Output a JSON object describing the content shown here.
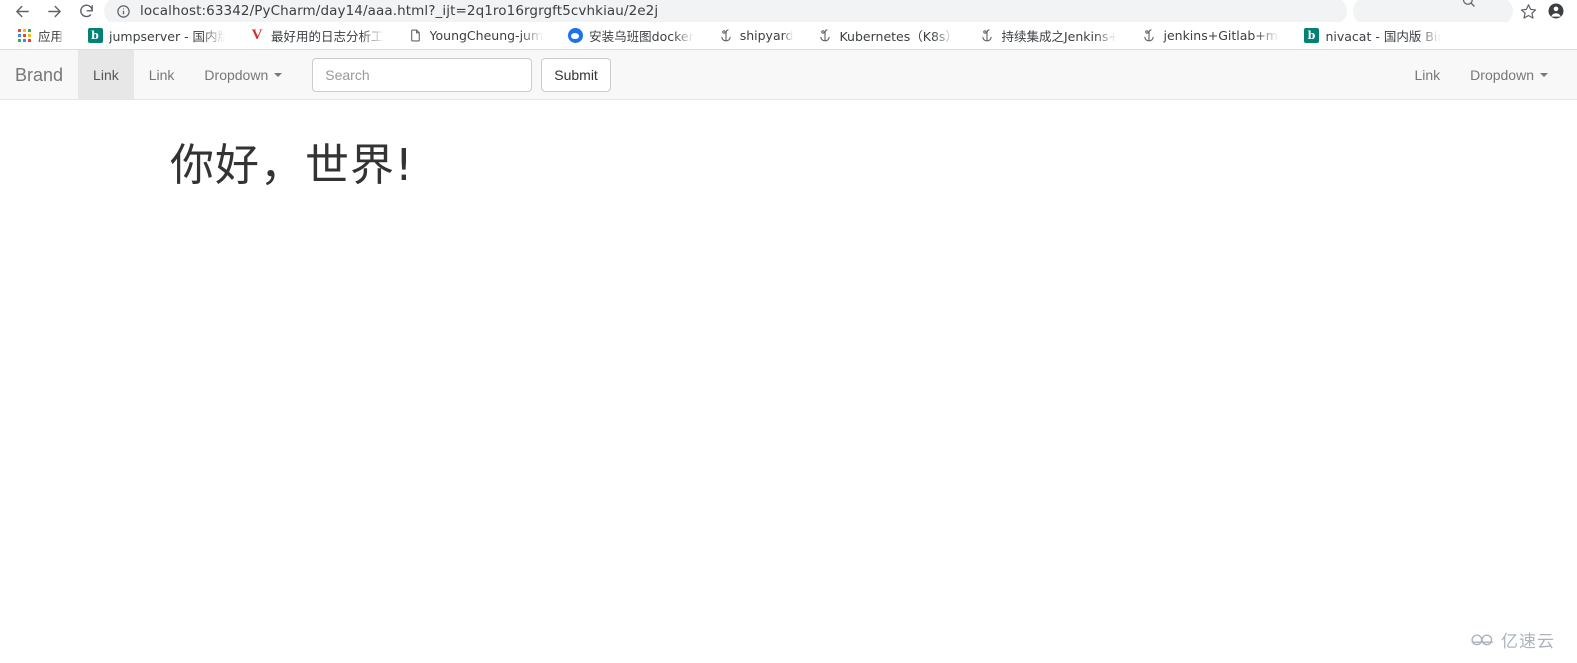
{
  "browser": {
    "nav": {
      "back_icon": "back-arrow-icon",
      "forward_icon": "forward-arrow-icon",
      "reload_icon": "reload-icon",
      "info_icon": "info-circle-icon"
    },
    "url": "localhost:63342/PyCharm/day14/aaa.html?_ijt=2q1ro16rgrgft5cvhkiau/2e2j",
    "right_icons": {
      "star_icon": "bookmark-star-icon",
      "avatar_icon": "profile-avatar-icon",
      "magnifier_icon": "magnifier-icon"
    },
    "bookmarks": [
      {
        "label": "应用",
        "icon": "apps-grid-icon"
      },
      {
        "label": "jumpserver - 国内版",
        "icon": "bing-b-icon"
      },
      {
        "label": "最好用的日志分析工",
        "icon": "v-letter-icon"
      },
      {
        "label": "YoungCheung-jum",
        "icon": "document-icon"
      },
      {
        "label": "安装乌班图docker",
        "icon": "blue-circle-icon"
      },
      {
        "label": "shipyard",
        "icon": "helm-icon"
      },
      {
        "label": "Kubernetes（K8s）",
        "icon": "helm-icon"
      },
      {
        "label": "持续集成之Jenkins+",
        "icon": "helm-icon"
      },
      {
        "label": "jenkins+Gitlab+ma",
        "icon": "helm-icon"
      },
      {
        "label": "nivacat - 国内版 Bin",
        "icon": "bing-b-icon"
      }
    ]
  },
  "navbar": {
    "brand": "Brand",
    "left_items": [
      {
        "label": "Link",
        "active": true,
        "dropdown": false
      },
      {
        "label": "Link",
        "active": false,
        "dropdown": false
      },
      {
        "label": "Dropdown",
        "active": false,
        "dropdown": true
      }
    ],
    "search": {
      "value": "",
      "placeholder": "Search"
    },
    "submit_label": "Submit",
    "right_items": [
      {
        "label": "Link",
        "active": false,
        "dropdown": false
      },
      {
        "label": "Dropdown",
        "active": false,
        "dropdown": true
      }
    ],
    "colors": {
      "background": "#f8f8f8",
      "active_background": "#e7e7e7",
      "text": "#777777",
      "active_text": "#555555",
      "border": "#e7e7e7"
    }
  },
  "main": {
    "heading": "你好，世界!"
  },
  "watermark": {
    "text": "亿速云",
    "icon": "cloud-icon",
    "color": "#9aa3b0"
  }
}
